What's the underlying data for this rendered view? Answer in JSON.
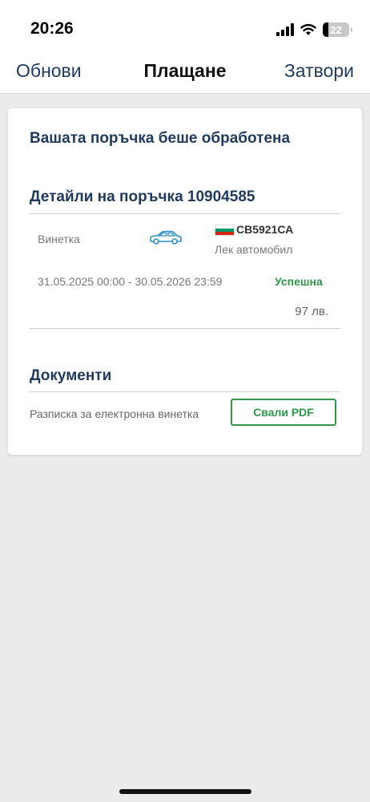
{
  "status_bar": {
    "time": "20:26",
    "battery_level": "22",
    "battery_fraction": 0.22,
    "icons": [
      "signal-icon",
      "wifi-icon",
      "battery-icon"
    ]
  },
  "nav": {
    "left_label": "Обнови",
    "title": "Плащане",
    "right_label": "Затвори"
  },
  "order": {
    "title": "Вашата поръчка беше обработена",
    "details_heading": "Детайли на поръчка 10904585",
    "item_type": "Винетка",
    "plate": "СВ5921СА",
    "vehicle_type": "Лек автомобил",
    "period": "31.05.2025 00:00 - 30.05.2026 23:59",
    "status": "Успешна",
    "price": "97 лв."
  },
  "documents": {
    "heading": "Документи",
    "label": "Разписка за електронна винетка",
    "download_button": "Свали PDF"
  },
  "colors": {
    "primary": "#1f3a5f",
    "success": "#2e9a47",
    "icon": "#2a8fc7",
    "flag": [
      "#ffffff",
      "#00966e",
      "#d62612"
    ]
  }
}
